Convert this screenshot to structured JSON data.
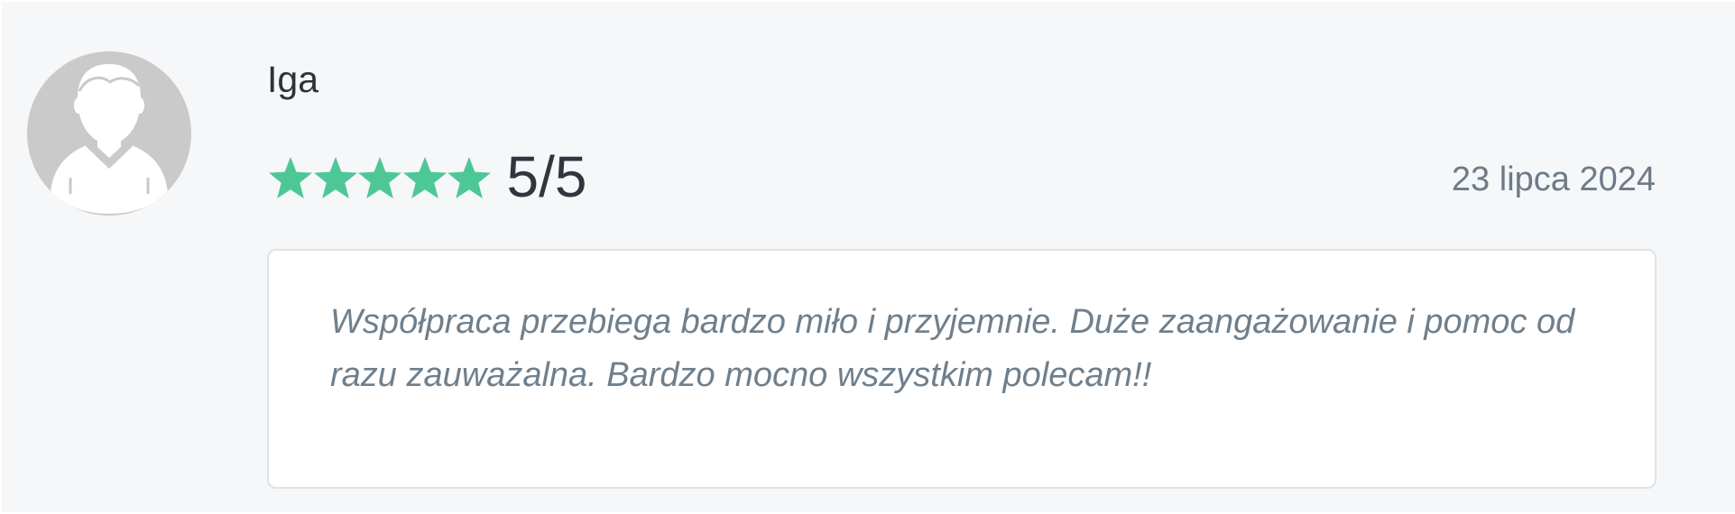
{
  "review": {
    "author": "Iga",
    "avatar_icon": "user-silhouette-icon",
    "rating": {
      "stars": 5,
      "max": 5,
      "label": "5/5",
      "star_icon": "star-icon",
      "star_color": "#4ec797"
    },
    "date": "23 lipca 2024",
    "text": "Współpraca przebiega bardzo miło i przyjemnie. Duże zaangażowanie i pomoc od razu zauważalna. Bardzo mocno wszystkim polecam!!"
  },
  "colors": {
    "card_background": "#f5f7f9",
    "avatar_background": "#cacaca",
    "name_text": "#2d333a",
    "date_text": "#6e7b87",
    "review_text": "#6f7f8c"
  }
}
